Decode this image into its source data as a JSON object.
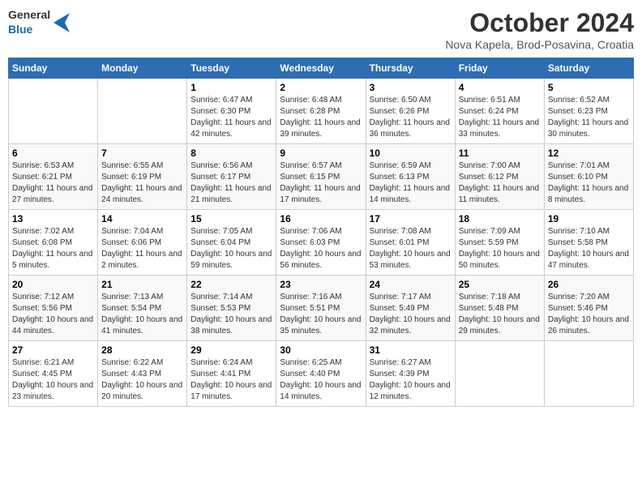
{
  "header": {
    "logo": {
      "general": "General",
      "blue": "Blue"
    },
    "title": "October 2024",
    "location": "Nova Kapela, Brod-Posavina, Croatia"
  },
  "calendar": {
    "weekdays": [
      "Sunday",
      "Monday",
      "Tuesday",
      "Wednesday",
      "Thursday",
      "Friday",
      "Saturday"
    ],
    "weeks": [
      [
        {
          "day": "",
          "sunrise": "",
          "sunset": "",
          "daylight": ""
        },
        {
          "day": "",
          "sunrise": "",
          "sunset": "",
          "daylight": ""
        },
        {
          "day": "1",
          "sunrise": "Sunrise: 6:47 AM",
          "sunset": "Sunset: 6:30 PM",
          "daylight": "Daylight: 11 hours and 42 minutes."
        },
        {
          "day": "2",
          "sunrise": "Sunrise: 6:48 AM",
          "sunset": "Sunset: 6:28 PM",
          "daylight": "Daylight: 11 hours and 39 minutes."
        },
        {
          "day": "3",
          "sunrise": "Sunrise: 6:50 AM",
          "sunset": "Sunset: 6:26 PM",
          "daylight": "Daylight: 11 hours and 36 minutes."
        },
        {
          "day": "4",
          "sunrise": "Sunrise: 6:51 AM",
          "sunset": "Sunset: 6:24 PM",
          "daylight": "Daylight: 11 hours and 33 minutes."
        },
        {
          "day": "5",
          "sunrise": "Sunrise: 6:52 AM",
          "sunset": "Sunset: 6:23 PM",
          "daylight": "Daylight: 11 hours and 30 minutes."
        }
      ],
      [
        {
          "day": "6",
          "sunrise": "Sunrise: 6:53 AM",
          "sunset": "Sunset: 6:21 PM",
          "daylight": "Daylight: 11 hours and 27 minutes."
        },
        {
          "day": "7",
          "sunrise": "Sunrise: 6:55 AM",
          "sunset": "Sunset: 6:19 PM",
          "daylight": "Daylight: 11 hours and 24 minutes."
        },
        {
          "day": "8",
          "sunrise": "Sunrise: 6:56 AM",
          "sunset": "Sunset: 6:17 PM",
          "daylight": "Daylight: 11 hours and 21 minutes."
        },
        {
          "day": "9",
          "sunrise": "Sunrise: 6:57 AM",
          "sunset": "Sunset: 6:15 PM",
          "daylight": "Daylight: 11 hours and 17 minutes."
        },
        {
          "day": "10",
          "sunrise": "Sunrise: 6:59 AM",
          "sunset": "Sunset: 6:13 PM",
          "daylight": "Daylight: 11 hours and 14 minutes."
        },
        {
          "day": "11",
          "sunrise": "Sunrise: 7:00 AM",
          "sunset": "Sunset: 6:12 PM",
          "daylight": "Daylight: 11 hours and 11 minutes."
        },
        {
          "day": "12",
          "sunrise": "Sunrise: 7:01 AM",
          "sunset": "Sunset: 6:10 PM",
          "daylight": "Daylight: 11 hours and 8 minutes."
        }
      ],
      [
        {
          "day": "13",
          "sunrise": "Sunrise: 7:02 AM",
          "sunset": "Sunset: 6:08 PM",
          "daylight": "Daylight: 11 hours and 5 minutes."
        },
        {
          "day": "14",
          "sunrise": "Sunrise: 7:04 AM",
          "sunset": "Sunset: 6:06 PM",
          "daylight": "Daylight: 11 hours and 2 minutes."
        },
        {
          "day": "15",
          "sunrise": "Sunrise: 7:05 AM",
          "sunset": "Sunset: 6:04 PM",
          "daylight": "Daylight: 10 hours and 59 minutes."
        },
        {
          "day": "16",
          "sunrise": "Sunrise: 7:06 AM",
          "sunset": "Sunset: 6:03 PM",
          "daylight": "Daylight: 10 hours and 56 minutes."
        },
        {
          "day": "17",
          "sunrise": "Sunrise: 7:08 AM",
          "sunset": "Sunset: 6:01 PM",
          "daylight": "Daylight: 10 hours and 53 minutes."
        },
        {
          "day": "18",
          "sunrise": "Sunrise: 7:09 AM",
          "sunset": "Sunset: 5:59 PM",
          "daylight": "Daylight: 10 hours and 50 minutes."
        },
        {
          "day": "19",
          "sunrise": "Sunrise: 7:10 AM",
          "sunset": "Sunset: 5:58 PM",
          "daylight": "Daylight: 10 hours and 47 minutes."
        }
      ],
      [
        {
          "day": "20",
          "sunrise": "Sunrise: 7:12 AM",
          "sunset": "Sunset: 5:56 PM",
          "daylight": "Daylight: 10 hours and 44 minutes."
        },
        {
          "day": "21",
          "sunrise": "Sunrise: 7:13 AM",
          "sunset": "Sunset: 5:54 PM",
          "daylight": "Daylight: 10 hours and 41 minutes."
        },
        {
          "day": "22",
          "sunrise": "Sunrise: 7:14 AM",
          "sunset": "Sunset: 5:53 PM",
          "daylight": "Daylight: 10 hours and 38 minutes."
        },
        {
          "day": "23",
          "sunrise": "Sunrise: 7:16 AM",
          "sunset": "Sunset: 5:51 PM",
          "daylight": "Daylight: 10 hours and 35 minutes."
        },
        {
          "day": "24",
          "sunrise": "Sunrise: 7:17 AM",
          "sunset": "Sunset: 5:49 PM",
          "daylight": "Daylight: 10 hours and 32 minutes."
        },
        {
          "day": "25",
          "sunrise": "Sunrise: 7:18 AM",
          "sunset": "Sunset: 5:48 PM",
          "daylight": "Daylight: 10 hours and 29 minutes."
        },
        {
          "day": "26",
          "sunrise": "Sunrise: 7:20 AM",
          "sunset": "Sunset: 5:46 PM",
          "daylight": "Daylight: 10 hours and 26 minutes."
        }
      ],
      [
        {
          "day": "27",
          "sunrise": "Sunrise: 6:21 AM",
          "sunset": "Sunset: 4:45 PM",
          "daylight": "Daylight: 10 hours and 23 minutes."
        },
        {
          "day": "28",
          "sunrise": "Sunrise: 6:22 AM",
          "sunset": "Sunset: 4:43 PM",
          "daylight": "Daylight: 10 hours and 20 minutes."
        },
        {
          "day": "29",
          "sunrise": "Sunrise: 6:24 AM",
          "sunset": "Sunset: 4:41 PM",
          "daylight": "Daylight: 10 hours and 17 minutes."
        },
        {
          "day": "30",
          "sunrise": "Sunrise: 6:25 AM",
          "sunset": "Sunset: 4:40 PM",
          "daylight": "Daylight: 10 hours and 14 minutes."
        },
        {
          "day": "31",
          "sunrise": "Sunrise: 6:27 AM",
          "sunset": "Sunset: 4:39 PM",
          "daylight": "Daylight: 10 hours and 12 minutes."
        },
        {
          "day": "",
          "sunrise": "",
          "sunset": "",
          "daylight": ""
        },
        {
          "day": "",
          "sunrise": "",
          "sunset": "",
          "daylight": ""
        }
      ]
    ]
  }
}
